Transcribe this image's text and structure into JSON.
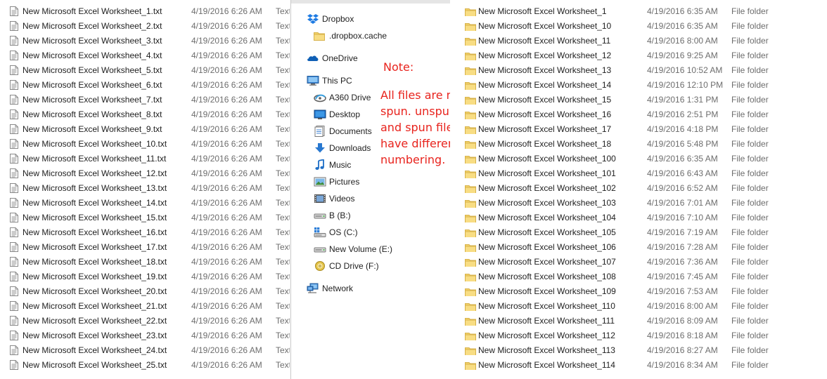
{
  "left": {
    "type_label": "Text",
    "files": [
      {
        "name": "New Microsoft Excel Worksheet_1.txt",
        "date": "4/19/2016 6:26 AM"
      },
      {
        "name": "New Microsoft Excel Worksheet_2.txt",
        "date": "4/19/2016 6:26 AM"
      },
      {
        "name": "New Microsoft Excel Worksheet_3.txt",
        "date": "4/19/2016 6:26 AM"
      },
      {
        "name": "New Microsoft Excel Worksheet_4.txt",
        "date": "4/19/2016 6:26 AM"
      },
      {
        "name": "New Microsoft Excel Worksheet_5.txt",
        "date": "4/19/2016 6:26 AM"
      },
      {
        "name": "New Microsoft Excel Worksheet_6.txt",
        "date": "4/19/2016 6:26 AM"
      },
      {
        "name": "New Microsoft Excel Worksheet_7.txt",
        "date": "4/19/2016 6:26 AM"
      },
      {
        "name": "New Microsoft Excel Worksheet_8.txt",
        "date": "4/19/2016 6:26 AM"
      },
      {
        "name": "New Microsoft Excel Worksheet_9.txt",
        "date": "4/19/2016 6:26 AM"
      },
      {
        "name": "New Microsoft Excel Worksheet_10.txt",
        "date": "4/19/2016 6:26 AM"
      },
      {
        "name": "New Microsoft Excel Worksheet_11.txt",
        "date": "4/19/2016 6:26 AM"
      },
      {
        "name": "New Microsoft Excel Worksheet_12.txt",
        "date": "4/19/2016 6:26 AM"
      },
      {
        "name": "New Microsoft Excel Worksheet_13.txt",
        "date": "4/19/2016 6:26 AM"
      },
      {
        "name": "New Microsoft Excel Worksheet_14.txt",
        "date": "4/19/2016 6:26 AM"
      },
      {
        "name": "New Microsoft Excel Worksheet_15.txt",
        "date": "4/19/2016 6:26 AM"
      },
      {
        "name": "New Microsoft Excel Worksheet_16.txt",
        "date": "4/19/2016 6:26 AM"
      },
      {
        "name": "New Microsoft Excel Worksheet_17.txt",
        "date": "4/19/2016 6:26 AM"
      },
      {
        "name": "New Microsoft Excel Worksheet_18.txt",
        "date": "4/19/2016 6:26 AM"
      },
      {
        "name": "New Microsoft Excel Worksheet_19.txt",
        "date": "4/19/2016 6:26 AM"
      },
      {
        "name": "New Microsoft Excel Worksheet_20.txt",
        "date": "4/19/2016 6:26 AM"
      },
      {
        "name": "New Microsoft Excel Worksheet_21.txt",
        "date": "4/19/2016 6:26 AM"
      },
      {
        "name": "New Microsoft Excel Worksheet_22.txt",
        "date": "4/19/2016 6:26 AM"
      },
      {
        "name": "New Microsoft Excel Worksheet_23.txt",
        "date": "4/19/2016 6:26 AM"
      },
      {
        "name": "New Microsoft Excel Worksheet_24.txt",
        "date": "4/19/2016 6:26 AM"
      },
      {
        "name": "New Microsoft Excel Worksheet_25.txt",
        "date": "4/19/2016 6:26 AM"
      }
    ]
  },
  "nav": {
    "items": [
      {
        "label": "Dropbox",
        "icon": "dropbox-icon"
      },
      {
        "label": ".dropbox.cache",
        "icon": "folder-icon"
      },
      {
        "label": "OneDrive",
        "icon": "onedrive-icon"
      },
      {
        "label": "This PC",
        "icon": "computer-icon"
      },
      {
        "label": "A360 Drive",
        "icon": "a360-drive-icon"
      },
      {
        "label": "Desktop",
        "icon": "desktop-icon"
      },
      {
        "label": "Documents",
        "icon": "documents-icon"
      },
      {
        "label": "Downloads",
        "icon": "downloads-icon"
      },
      {
        "label": "Music",
        "icon": "music-icon"
      },
      {
        "label": "Pictures",
        "icon": "pictures-icon"
      },
      {
        "label": "Videos",
        "icon": "videos-icon"
      },
      {
        "label": "B (B:)",
        "icon": "drive-icon"
      },
      {
        "label": "OS (C:)",
        "icon": "windows-drive-icon"
      },
      {
        "label": "New Volume (E:)",
        "icon": "drive-icon"
      },
      {
        "label": "CD Drive (F:)",
        "icon": "cd-drive-icon"
      },
      {
        "label": "Network",
        "icon": "network-icon"
      }
    ]
  },
  "note": {
    "title": "Note:",
    "lines": [
      "All files are not",
      "spun. unspun",
      "and spun files",
      "have different",
      "numbering."
    ]
  },
  "right": {
    "type_label": "File folder",
    "folders": [
      {
        "name": "New Microsoft Excel Worksheet_1",
        "date": "4/19/2016 6:35 AM"
      },
      {
        "name": "New Microsoft Excel Worksheet_10",
        "date": "4/19/2016 6:35 AM"
      },
      {
        "name": "New Microsoft Excel Worksheet_11",
        "date": "4/19/2016 8:00 AM"
      },
      {
        "name": "New Microsoft Excel Worksheet_12",
        "date": "4/19/2016 9:25 AM"
      },
      {
        "name": "New Microsoft Excel Worksheet_13",
        "date": "4/19/2016 10:52 AM"
      },
      {
        "name": "New Microsoft Excel Worksheet_14",
        "date": "4/19/2016 12:10 PM"
      },
      {
        "name": "New Microsoft Excel Worksheet_15",
        "date": "4/19/2016 1:31 PM"
      },
      {
        "name": "New Microsoft Excel Worksheet_16",
        "date": "4/19/2016 2:51 PM"
      },
      {
        "name": "New Microsoft Excel Worksheet_17",
        "date": "4/19/2016 4:18 PM"
      },
      {
        "name": "New Microsoft Excel Worksheet_18",
        "date": "4/19/2016 5:48 PM"
      },
      {
        "name": "New Microsoft Excel Worksheet_100",
        "date": "4/19/2016 6:35 AM"
      },
      {
        "name": "New Microsoft Excel Worksheet_101",
        "date": "4/19/2016 6:43 AM"
      },
      {
        "name": "New Microsoft Excel Worksheet_102",
        "date": "4/19/2016 6:52 AM"
      },
      {
        "name": "New Microsoft Excel Worksheet_103",
        "date": "4/19/2016 7:01 AM"
      },
      {
        "name": "New Microsoft Excel Worksheet_104",
        "date": "4/19/2016 7:10 AM"
      },
      {
        "name": "New Microsoft Excel Worksheet_105",
        "date": "4/19/2016 7:19 AM"
      },
      {
        "name": "New Microsoft Excel Worksheet_106",
        "date": "4/19/2016 7:28 AM"
      },
      {
        "name": "New Microsoft Excel Worksheet_107",
        "date": "4/19/2016 7:36 AM"
      },
      {
        "name": "New Microsoft Excel Worksheet_108",
        "date": "4/19/2016 7:45 AM"
      },
      {
        "name": "New Microsoft Excel Worksheet_109",
        "date": "4/19/2016 7:53 AM"
      },
      {
        "name": "New Microsoft Excel Worksheet_110",
        "date": "4/19/2016 8:00 AM"
      },
      {
        "name": "New Microsoft Excel Worksheet_111",
        "date": "4/19/2016 8:09 AM"
      },
      {
        "name": "New Microsoft Excel Worksheet_112",
        "date": "4/19/2016 8:18 AM"
      },
      {
        "name": "New Microsoft Excel Worksheet_113",
        "date": "4/19/2016 8:27 AM"
      },
      {
        "name": "New Microsoft Excel Worksheet_114",
        "date": "4/19/2016 8:34 AM"
      }
    ]
  },
  "colors": {
    "note_red": "#e8231d",
    "folder_yellow": "#f3d26b",
    "meta_gray": "#6d6d6d"
  }
}
